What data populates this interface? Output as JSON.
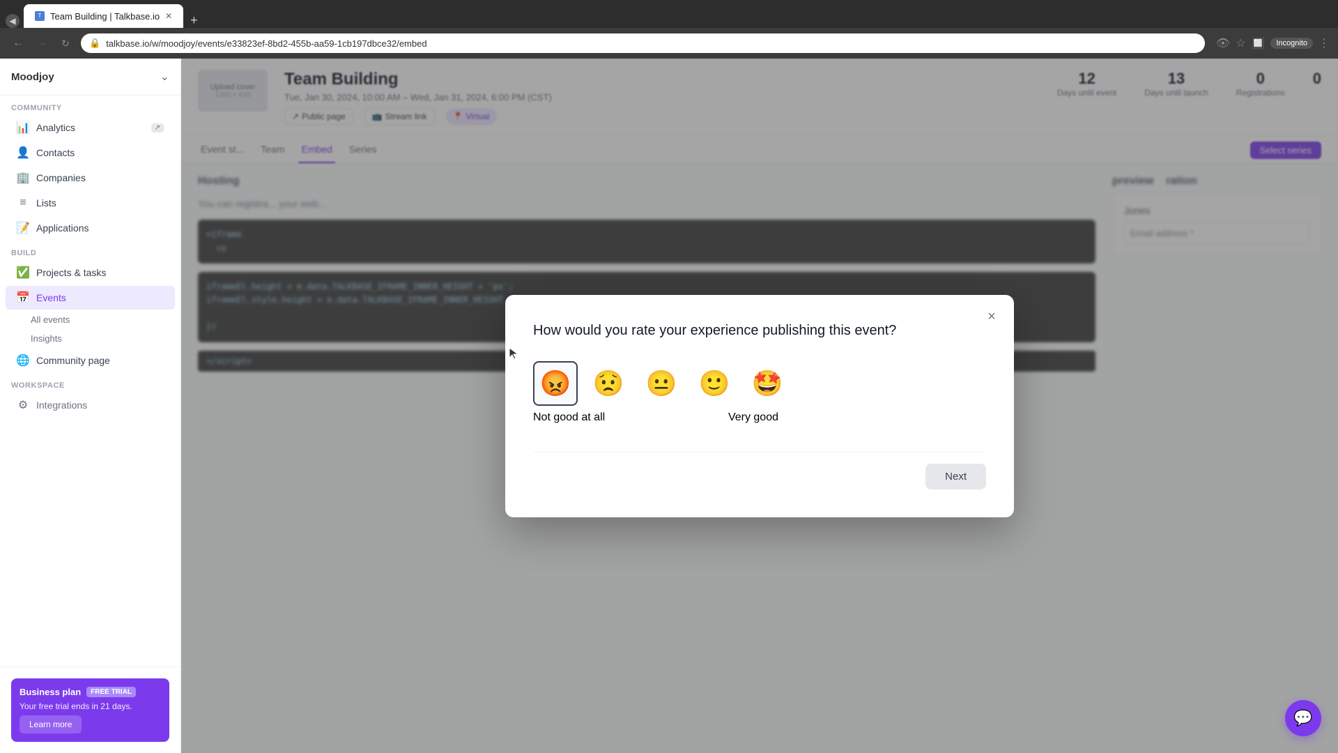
{
  "browser": {
    "tab_title": "Team Building | Talkbase.io",
    "url": "talkbase.io/w/moodjoy/events/e33823ef-8bd2-455b-aa59-1cb197dbce32/embed",
    "incognito_label": "Incognito"
  },
  "sidebar": {
    "brand": "Moodjoy",
    "sections": {
      "community_label": "COMMUNITY",
      "workspace_label": "WORKSPACE"
    },
    "items": [
      {
        "id": "analytics",
        "label": "Analytics",
        "icon": "📊"
      },
      {
        "id": "contacts",
        "label": "Contacts",
        "icon": "👤"
      },
      {
        "id": "companies",
        "label": "Companies",
        "icon": "🏢"
      },
      {
        "id": "lists",
        "label": "Lists",
        "icon": "📋"
      },
      {
        "id": "applications",
        "label": "Applications",
        "icon": "📝"
      },
      {
        "id": "projects",
        "label": "Projects & tasks",
        "icon": "✅"
      },
      {
        "id": "events",
        "label": "Events",
        "icon": "📅",
        "active": true
      },
      {
        "id": "community",
        "label": "Community page",
        "icon": "🌐"
      }
    ],
    "sub_items": [
      {
        "id": "all-events",
        "label": "All events"
      },
      {
        "id": "insights",
        "label": "Insights"
      }
    ],
    "business_plan": {
      "title": "Business plan",
      "badge": "FREE TRIAL",
      "description": "Your free trial ends in 21 days.",
      "cta": "Learn more"
    }
  },
  "event": {
    "title": "Team Building",
    "date": "Tue, Jan 30, 2024, 10:00 AM – Wed, Jan 31, 2024, 6:00 PM (CST)",
    "public_page_label": "Public page",
    "stream_link_label": "Stream link",
    "format": "Virtual",
    "upload_cover_label": "Upload cover",
    "upload_cover_size": "1200 × 630",
    "stats": [
      {
        "value": "12",
        "label": "Days until event"
      },
      {
        "value": "13",
        "label": "Days until launch"
      },
      {
        "value": "0",
        "label": "Registrations"
      },
      {
        "value": "0",
        "label": ""
      }
    ]
  },
  "modal": {
    "title": "How would you rate your experience publishing this event?",
    "close_label": "×",
    "emojis": [
      {
        "id": "very-bad",
        "symbol": "😡",
        "selected": true
      },
      {
        "id": "bad",
        "symbol": "😟",
        "selected": false
      },
      {
        "id": "neutral",
        "symbol": "😐",
        "selected": false
      },
      {
        "id": "good",
        "symbol": "🙂",
        "selected": false
      },
      {
        "id": "very-good",
        "symbol": "🤩",
        "selected": false
      }
    ],
    "label_left": "Not good at all",
    "label_right": "Very good",
    "next_button": "Next"
  },
  "tabs": [
    {
      "id": "event-stream",
      "label": "Event st...",
      "active": false
    },
    {
      "id": "embed",
      "label": "Embed",
      "active": true
    },
    {
      "id": "team",
      "label": "Team",
      "active": false
    },
    {
      "id": "series",
      "label": "Series",
      "active": false
    }
  ],
  "embed_content": {
    "hosting_label": "Hosting",
    "code_snippet": "<iframe\n  <s",
    "code_snippet2": "iframeEl.height = e.data.TALKBASE_IFRAME_INNER_HEIGHT + 'px';\niframeEl.style.height = e.data.TALKBASE_IFRAME_INNER_HEIGHT",
    "registration_label": "ration",
    "preview_label": "preview",
    "select_series_label": "Select series",
    "first_name_label": "Jones",
    "email_label": "Email address *"
  },
  "colors": {
    "primary": "#7c3aed",
    "primary_light": "#ede9fe",
    "border": "#e5e7eb",
    "text_primary": "#111827",
    "text_secondary": "#6b7280"
  }
}
